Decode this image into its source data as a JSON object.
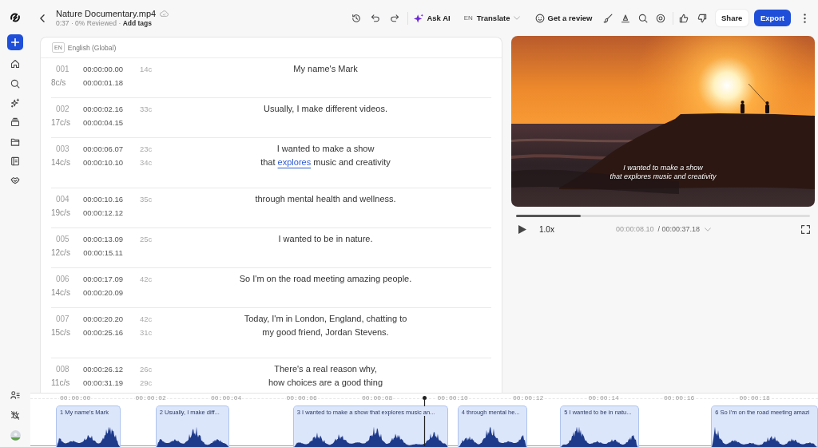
{
  "header": {
    "title": "Nature Documentary.mp4",
    "meta": "0:37 · 0% Reviewed ·",
    "add_tags": "Add tags"
  },
  "toolbar": {
    "ask_ai": "Ask AI",
    "language_code": "EN",
    "translate": "Translate",
    "review": "Get a review",
    "share": "Share",
    "export": "Export"
  },
  "editor": {
    "language_code": "EN",
    "language": "English (Global)"
  },
  "subtitles": [
    {
      "index": "001",
      "cps": "8c/s",
      "start": "00:00:00.00",
      "end": "00:00:01.18",
      "char_counts": [
        "14c"
      ],
      "lines": [
        "My name's Mark"
      ]
    },
    {
      "index": "002",
      "cps": "17c/s",
      "start": "00:00:02.16",
      "end": "00:00:04.15",
      "char_counts": [
        "33c"
      ],
      "lines": [
        "Usually, I make different videos."
      ]
    },
    {
      "index": "003",
      "cps": "14c/s",
      "start": "00:00:06.07",
      "end": "00:00:10.10",
      "char_counts": [
        "23c",
        "34c"
      ],
      "lines": [
        "I wanted to make a show",
        {
          "segments": [
            {
              "text": "that ",
              "marked": false
            },
            {
              "text": "explores",
              "marked": true
            },
            {
              "text": " music and creativity",
              "marked": false
            }
          ]
        }
      ]
    },
    {
      "index": "004",
      "cps": "19c/s",
      "start": "00:00:10.16",
      "end": "00:00:12.12",
      "char_counts": [
        "35c"
      ],
      "lines": [
        "through mental health and wellness."
      ]
    },
    {
      "index": "005",
      "cps": "12c/s",
      "start": "00:00:13.09",
      "end": "00:00:15.11",
      "char_counts": [
        "25c"
      ],
      "lines": [
        "I wanted to be in nature."
      ]
    },
    {
      "index": "006",
      "cps": "14c/s",
      "start": "00:00:17.09",
      "end": "00:00:20.09",
      "char_counts": [
        "42c"
      ],
      "lines": [
        "So I'm on the road meeting amazing people."
      ]
    },
    {
      "index": "007",
      "cps": "15c/s",
      "start": "00:00:20.20",
      "end": "00:00:25.16",
      "char_counts": [
        "42c",
        "31c"
      ],
      "lines": [
        "Today, I'm in London, England, chatting to",
        "my good friend, Jordan Stevens."
      ]
    },
    {
      "index": "008",
      "cps": "11c/s",
      "start": "00:00:26.12",
      "end": "00:00:31.19",
      "char_counts": [
        "26c",
        "29c"
      ],
      "lines": [
        "There's a real reason why,",
        "how choices are a good thing"
      ]
    }
  ],
  "player": {
    "caption": [
      "I wanted to make a show",
      "that explores music and creativity"
    ],
    "progress": {
      "level": 0.22
    },
    "speed": "1.0x",
    "current_time": "00:00:08.10",
    "total_time": "/ 00:00:37.18"
  },
  "timeline": {
    "ruler": [
      "00:00:00",
      "00:00:02",
      "00:00:04",
      "00:00:06",
      "00:00:08",
      "00:00:10",
      "00:00:12",
      "00:00:14",
      "00:00:16",
      "00:00:18"
    ],
    "clips": [
      {
        "label": "1 My name's Mark"
      },
      {
        "label": "2 Usually, I make diff..."
      },
      {
        "label": "3 I wanted to make a show that explores music an..."
      },
      {
        "label": "4 through mental he..."
      },
      {
        "label": "5 I wanted to be in natu..."
      },
      {
        "label": "6 So I'm on the road meeting amazi"
      }
    ],
    "playhead": {
      "level": 0.5
    }
  }
}
